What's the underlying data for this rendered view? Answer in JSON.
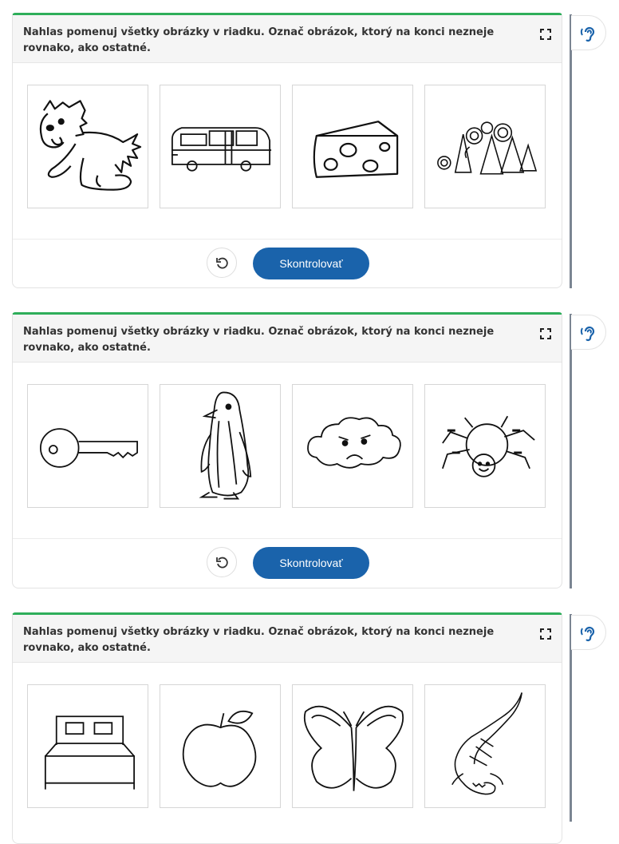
{
  "exercises": [
    {
      "instruction": "Nahlas pomenuj všetky obrázky v riadku. Označ obrázok, ktorý na konci nezneje rovnako, ako ostatné.",
      "pictures": [
        "dog-picture",
        "bus-picture",
        "cheese-picture",
        "forest-picture"
      ],
      "reset_label": "",
      "check_label": "Skontrolovať"
    },
    {
      "instruction": "Nahlas pomenuj všetky obrázky v riadku. Označ obrázok, ktorý na konci nezneje rovnako, ako ostatné.",
      "pictures": [
        "key-picture",
        "penguin-picture",
        "cloud-picture",
        "spider-picture"
      ],
      "reset_label": "",
      "check_label": "Skontrolovať"
    },
    {
      "instruction": "Nahlas pomenuj všetky obrázky v riadku. Označ obrázok, ktorý na konci nezneje rovnako, ako ostatné.",
      "pictures": [
        "bed-picture",
        "apple-picture",
        "butterfly-picture",
        "crocodile-picture"
      ]
    }
  ],
  "colors": {
    "accent_green": "#2eae5a",
    "primary_blue": "#1a63ab",
    "ear_blue": "#1a63ab"
  },
  "icons": {
    "expand": "expand-icon",
    "reset": "reset-icon",
    "listen": "ear-icon"
  }
}
